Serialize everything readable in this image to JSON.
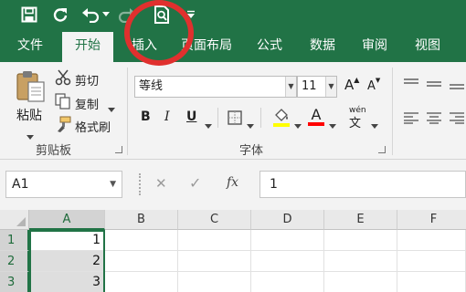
{
  "colors": {
    "brand": "#217346",
    "annotation": "#e0302e",
    "font_color_red": "#ff0000"
  },
  "qat": {
    "icons": [
      "save-icon",
      "repeat-icon",
      "undo-icon",
      "redo-icon",
      "print-preview-icon",
      "customize-arrow-icon"
    ]
  },
  "tabs": [
    {
      "label": "文件"
    },
    {
      "label": "开始"
    },
    {
      "label": "插入"
    },
    {
      "label": "页面布局"
    },
    {
      "label": "公式"
    },
    {
      "label": "数据"
    },
    {
      "label": "审阅"
    },
    {
      "label": "视图"
    }
  ],
  "ribbon": {
    "clipboard": {
      "paste_label": "粘贴",
      "cut_label": "剪切",
      "copy_label": "复制",
      "format_painter_label": "格式刷",
      "group_label": "剪贴板"
    },
    "font": {
      "font_name": "等线",
      "font_size": "11",
      "bold": "B",
      "italic": "I",
      "underline": "U",
      "grow": "A",
      "shrink": "A",
      "font_color": "A",
      "phonetic": "wén",
      "group_label": "字体"
    }
  },
  "formula_bar": {
    "name_box": "A1",
    "cancel": "✕",
    "enter": "✓",
    "fx": "fx",
    "value": "1"
  },
  "grid": {
    "columns": [
      "A",
      "B",
      "C",
      "D",
      "E",
      "F"
    ],
    "rows": [
      {
        "label": "1",
        "A": "1"
      },
      {
        "label": "2",
        "A": "2"
      },
      {
        "label": "3",
        "A": "3"
      }
    ]
  }
}
